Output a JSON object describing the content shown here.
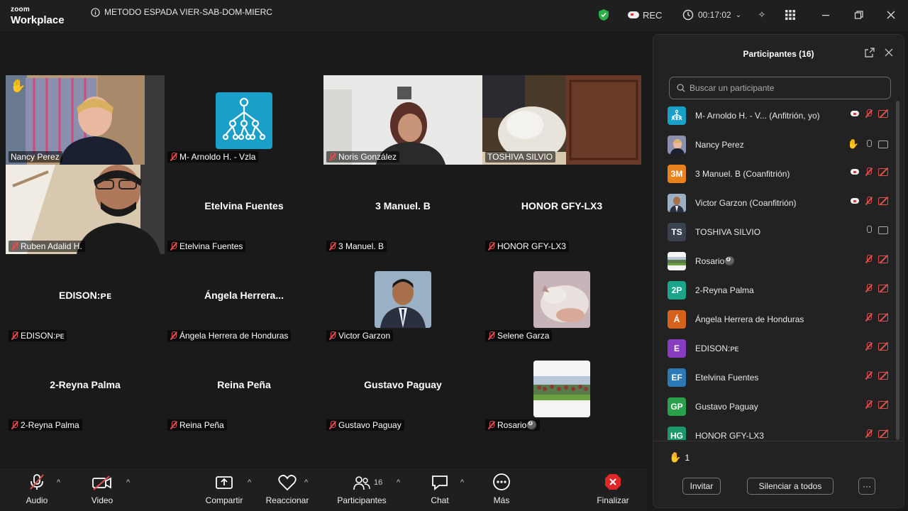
{
  "titlebar": {
    "brand_top": "zoom",
    "brand_bottom": "Workplace",
    "meeting_title": "METODO ESPADA VIER-SAB-DOM-MIERC",
    "rec_label": "REC",
    "timer": "00:17:02"
  },
  "tiles": [
    {
      "name": "Nancy Perez",
      "type": "video",
      "active": true,
      "hand": true
    },
    {
      "name": "M- Arnoldo H. - Vzla",
      "type": "avatar-img"
    },
    {
      "name": "Noris González",
      "type": "video"
    },
    {
      "name": "TOSHIVA SILVIO",
      "type": "video"
    },
    {
      "name": "Ruben Adalid H.",
      "type": "video"
    },
    {
      "name": "Etelvina Fuentes",
      "center": "Etelvina Fuentes",
      "type": "name"
    },
    {
      "name": "3 Manuel. B",
      "center": "3 Manuel. B",
      "type": "name"
    },
    {
      "name": "HONOR GFY-LX3",
      "center": "HONOR GFY-LX3",
      "type": "name"
    },
    {
      "name": "EDISON:ᴘᴇ",
      "center": "EDISON:ᴘᴇ",
      "type": "name"
    },
    {
      "name": "Ángela Herrera de Honduras",
      "center": "Ángela  Herrera...",
      "type": "name"
    },
    {
      "name": "Victor Garzon",
      "type": "avatar-img"
    },
    {
      "name": "Selene Garza",
      "type": "avatar-img"
    },
    {
      "name": "2-Reyna Palma",
      "center": "2-Reyna Palma",
      "type": "name"
    },
    {
      "name": "Reina Peña",
      "center": "Reina Peña",
      "type": "name"
    },
    {
      "name": "Gustavo Paguay",
      "center": "Gustavo Paguay",
      "type": "name"
    },
    {
      "name": "Rosario🎱",
      "type": "avatar-img"
    }
  ],
  "panel": {
    "title": "Participantes (16)",
    "search_placeholder": "Buscar un participante",
    "participants": [
      {
        "name": "M- Arnoldo H. - V...  (Anfitrión, yo)",
        "initials": "",
        "color": "#1aa0c8"
      },
      {
        "name": "Nancy Perez",
        "initials": "",
        "color": "#a08070"
      },
      {
        "name": "3 Manuel. B (Coanfitrión)",
        "initials": "3M",
        "color": "#e8821c"
      },
      {
        "name": "Victor Garzon (Coanfitrión)",
        "initials": "",
        "color": "#3a4a6a"
      },
      {
        "name": "TOSHIVA SILVIO",
        "initials": "TS",
        "color": "#3a4250"
      },
      {
        "name": "Rosario🎱",
        "initials": "",
        "color": "#6a8a5a"
      },
      {
        "name": "2-Reyna Palma",
        "initials": "2P",
        "color": "#1ba58a"
      },
      {
        "name": "Ángela Herrera de Honduras",
        "initials": "Á",
        "color": "#d4621c"
      },
      {
        "name": "EDISON:ᴘᴇ",
        "initials": "E",
        "color": "#8a3cc0"
      },
      {
        "name": "Etelvina Fuentes",
        "initials": "EF",
        "color": "#2a7ab8"
      },
      {
        "name": "Gustavo Paguay",
        "initials": "GP",
        "color": "#2aa04a"
      },
      {
        "name": "HONOR GFY-LX3",
        "initials": "HG",
        "color": "#1a9a6a"
      }
    ],
    "raised_hands": "1",
    "invite": "Invitar",
    "mute_all": "Silenciar a todos",
    "more": "···"
  },
  "toolbar": {
    "audio": "Audio",
    "video": "Video",
    "share": "Compartir",
    "react": "Reaccionar",
    "participants": "Participantes",
    "participants_count": "16",
    "chat": "Chat",
    "more": "Más",
    "end": "Finalizar"
  }
}
